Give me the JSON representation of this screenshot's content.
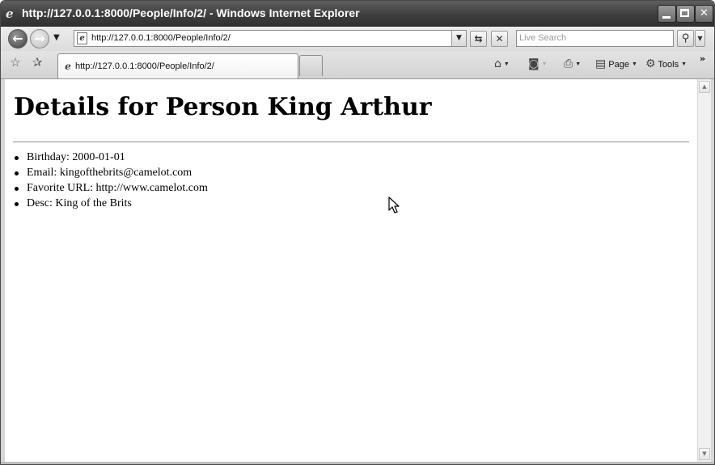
{
  "window": {
    "title": "http://127.0.0.1:8000/People/Info/2/ - Windows Internet Explorer"
  },
  "navbar": {
    "address": "http://127.0.0.1:8000/People/Info/2/",
    "search_placeholder": "Live Search"
  },
  "tabs": [
    {
      "label": "http://127.0.0.1:8000/People/Info/2/"
    }
  ],
  "command_bar": {
    "page_label": "Page",
    "tools_label": "Tools"
  },
  "page": {
    "heading": "Details for Person King Arthur",
    "details": [
      {
        "text": "Birthday: 2000-01-01"
      },
      {
        "text": "Email: kingofthebrits@camelot.com"
      },
      {
        "text": "Favorite URL: http://www.camelot.com"
      },
      {
        "text": "Desc: King of the Brits"
      }
    ]
  },
  "icons": {
    "back": "back-arrow-icon",
    "forward": "forward-arrow-icon",
    "refresh": "refresh-icon",
    "stop": "stop-icon",
    "search": "magnifier-icon",
    "favorites": "star-icon",
    "add_favorites": "add-star-icon",
    "home": "home-icon",
    "feeds": "rss-feed-icon",
    "print": "printer-icon",
    "page": "page-icon",
    "tools": "gear-icon"
  }
}
